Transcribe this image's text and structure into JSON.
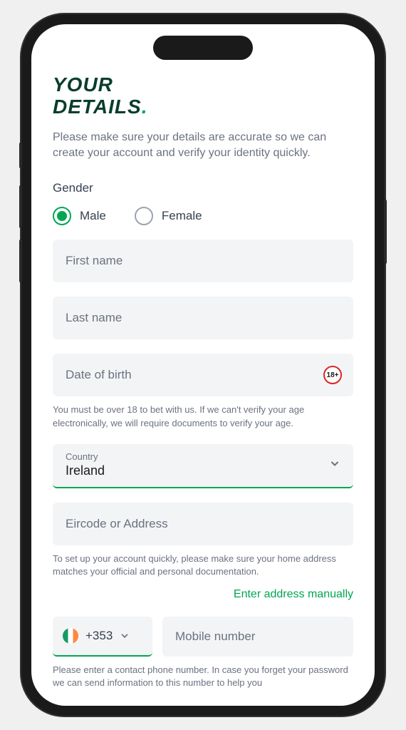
{
  "header": {
    "title_line1": "YOUR",
    "title_line2": "DETAILS",
    "title_punct": "."
  },
  "subtitle": "Please make sure your details are accurate so we can create your account and verify your identity quickly.",
  "gender": {
    "label": "Gender",
    "options": [
      {
        "label": "Male",
        "selected": true
      },
      {
        "label": "Female",
        "selected": false
      }
    ]
  },
  "fields": {
    "first_name": {
      "placeholder": "First name"
    },
    "last_name": {
      "placeholder": "Last name"
    },
    "dob": {
      "placeholder": "Date of birth",
      "badge": "18+"
    },
    "dob_helper": "You must be over 18 to bet with us. If we can't verify your age electronically, we will require documents to verify your age.",
    "country": {
      "label": "Country",
      "value": "Ireland"
    },
    "address": {
      "placeholder": "Eircode or Address"
    },
    "address_helper": "To set up your account quickly, please make sure your home address matches your official and personal documentation.",
    "manual_link": "Enter address manually",
    "phone_code": "+353",
    "phone": {
      "placeholder": "Mobile number"
    },
    "phone_helper": "Please enter a contact phone number. In case you forget your password we can send information to this number to help you"
  }
}
